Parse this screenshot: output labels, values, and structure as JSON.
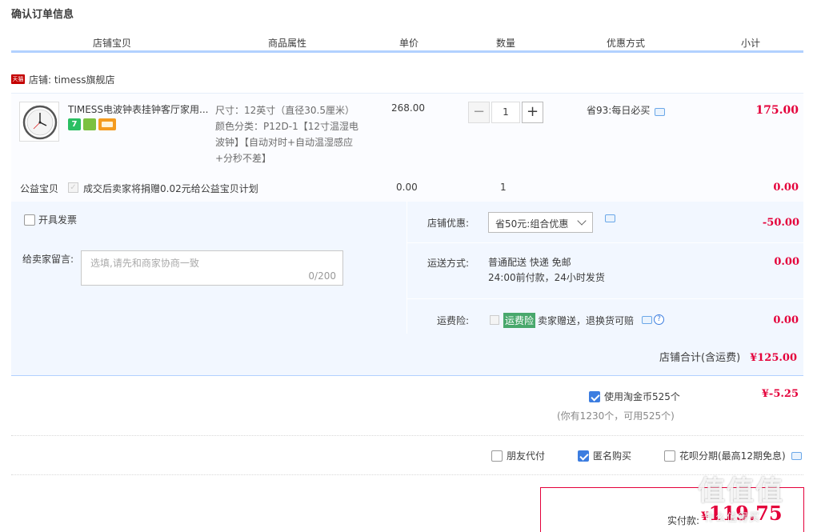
{
  "page_title": "确认订单信息",
  "columns": [
    "店铺宝贝",
    "商品属性",
    "单价",
    "数量",
    "优惠方式",
    "小计"
  ],
  "shop": {
    "badge": "天猫",
    "label": "店铺: timess旗舰店"
  },
  "item": {
    "title": "TIMESS电波钟表挂钟客厅家用...",
    "attr_size": "尺寸：12英寸（直径30.5厘米）",
    "attr_color": "颜色分类：P12D-1【12寸温湿电波钟】【自动对时+自动温湿感应+分秒不差】",
    "unit_price": "268.00",
    "qty": "1",
    "minus": "−",
    "plus": "+",
    "discount": "省93:每日必买",
    "subtotal": "175.00",
    "service_badge": "7"
  },
  "charity": {
    "label": "公益宝贝",
    "text": "成交后卖家将捐赠0.02元给公益宝贝计划",
    "price": "0.00",
    "qty": "1",
    "subtotal": "0.00"
  },
  "invoice_label": "开具发票",
  "message": {
    "label": "给卖家留言:",
    "placeholder": "选填,请先和商家协商一致",
    "count": "0/200"
  },
  "store_discount": {
    "label": "店铺优惠:",
    "selected": "省50元:组合优惠",
    "amount": "-50.00"
  },
  "shipping": {
    "label": "运送方式:",
    "line1": "普通配送 快递 免邮",
    "line2": "24:00前付款，24小时发货",
    "amount": "0.00"
  },
  "insurance": {
    "label": "运费险:",
    "tag": "运费险",
    "text": "卖家赠送，退换货可赔",
    "amount": "0.00",
    "help": "?"
  },
  "shop_total": {
    "label": "店铺合计(含运费)",
    "amount": "¥125.00"
  },
  "coins": {
    "label": "使用淘金币525个",
    "note": "(你有1230个，可用525个)",
    "amount": "¥-5.25"
  },
  "options": {
    "friend_pay": "朋友代付",
    "anonymous": "匿名购买",
    "huabei": "花呗分期(最高12期免息)"
  },
  "payment": {
    "label": "实付款:",
    "currency": "¥",
    "amount": "119.75"
  },
  "watermark": {
    "big": "值值值",
    "small": "什么值得买"
  },
  "colors": {
    "accent_red": "#e4003a",
    "header_line": "#b2d1ff",
    "panel_bg": "#f2f7ff",
    "check_blue": "#3c7de0"
  }
}
